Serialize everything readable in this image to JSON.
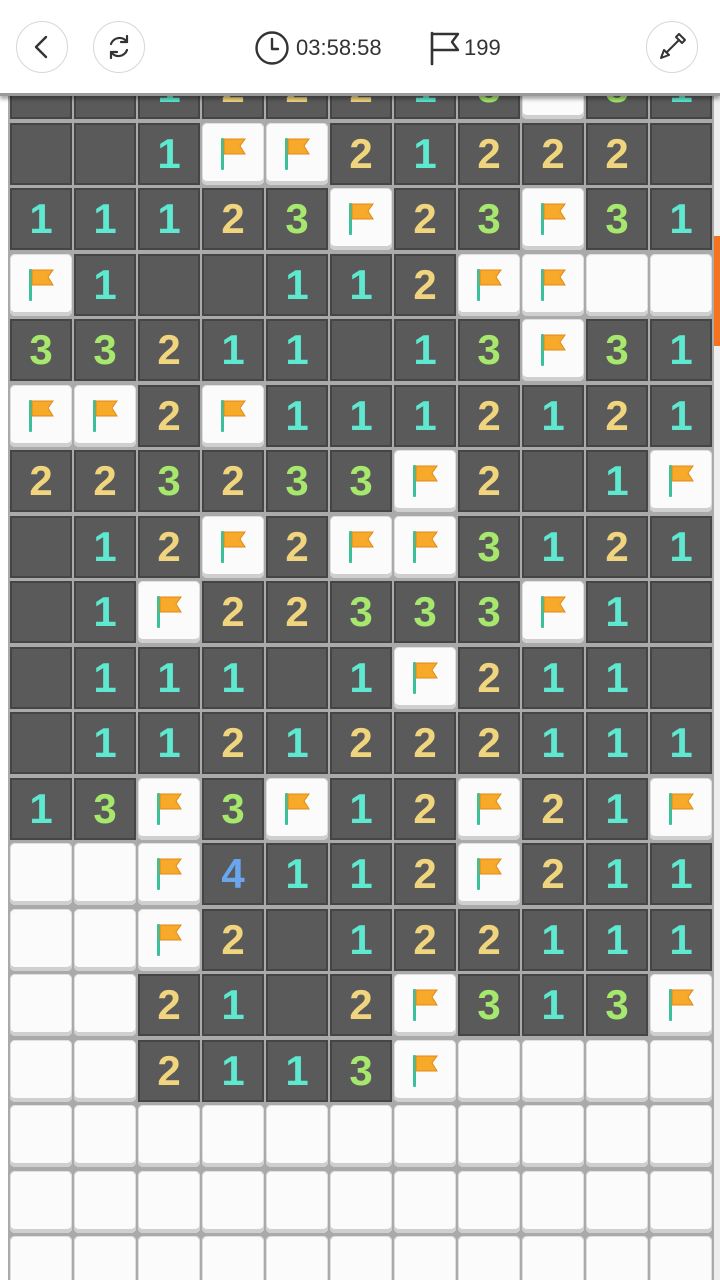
{
  "header": {
    "timer": "03:58:58",
    "flags_remaining": "199",
    "icons": {
      "back": "chevron-left-icon",
      "restart": "refresh-icon",
      "timer": "clock-icon",
      "flags": "flag-outline-icon",
      "tool": "shovel-icon"
    }
  },
  "board": {
    "legend": "digits = revealed count, F = flag, _ = revealed empty, # = unrevealed",
    "rows": [
      [
        "_",
        "_",
        "1",
        "2",
        "2",
        "2",
        "1",
        "3",
        "#",
        "3",
        "1"
      ],
      [
        "_",
        "_",
        "1",
        "F",
        "F",
        "2",
        "1",
        "2",
        "2",
        "2",
        "_"
      ],
      [
        "1",
        "1",
        "1",
        "2",
        "3",
        "F",
        "2",
        "3",
        "F",
        "3",
        "1"
      ],
      [
        "F",
        "1",
        "_",
        "_",
        "1",
        "1",
        "2",
        "F",
        "F",
        "#",
        "#"
      ],
      [
        "3",
        "3",
        "2",
        "1",
        "1",
        "_",
        "1",
        "3",
        "F",
        "3",
        "1"
      ],
      [
        "F",
        "F",
        "2",
        "F",
        "1",
        "1",
        "1",
        "2",
        "1",
        "2",
        "1"
      ],
      [
        "2",
        "2",
        "3",
        "2",
        "3",
        "3",
        "F",
        "2",
        "_",
        "1",
        "F"
      ],
      [
        "_",
        "1",
        "2",
        "F",
        "2",
        "F",
        "F",
        "3",
        "1",
        "2",
        "1"
      ],
      [
        "_",
        "1",
        "F",
        "2",
        "2",
        "3",
        "3",
        "3",
        "F",
        "1",
        "_"
      ],
      [
        "_",
        "1",
        "1",
        "1",
        "_",
        "1",
        "F",
        "2",
        "1",
        "1",
        "_"
      ],
      [
        "_",
        "1",
        "1",
        "2",
        "1",
        "2",
        "2",
        "2",
        "1",
        "1",
        "1"
      ],
      [
        "1",
        "3",
        "F",
        "3",
        "F",
        "1",
        "2",
        "F",
        "2",
        "1",
        "F"
      ],
      [
        "#",
        "#",
        "F",
        "4",
        "1",
        "1",
        "2",
        "F",
        "2",
        "1",
        "1"
      ],
      [
        "#",
        "#",
        "F",
        "2",
        "_",
        "1",
        "2",
        "2",
        "1",
        "1",
        "1"
      ],
      [
        "#",
        "#",
        "2",
        "1",
        "_",
        "2",
        "F",
        "3",
        "1",
        "3",
        "F"
      ],
      [
        "#",
        "#",
        "2",
        "1",
        "1",
        "3",
        "F",
        "#",
        "#",
        "#",
        "#"
      ],
      [
        "#",
        "#",
        "#",
        "#",
        "#",
        "#",
        "#",
        "#",
        "#",
        "#",
        "#"
      ],
      [
        "#",
        "#",
        "#",
        "#",
        "#",
        "#",
        "#",
        "#",
        "#",
        "#",
        "#"
      ],
      [
        "#",
        "#",
        "#",
        "#",
        "#",
        "#",
        "#",
        "#",
        "#",
        "#",
        "#"
      ]
    ],
    "number_colors": {
      "1": "#5de8cf",
      "2": "#f1d57e",
      "3": "#a6e86d",
      "4": "#6aa6ee"
    },
    "flag_color": "#f7a92a",
    "scroll_accent": "#f47321"
  }
}
